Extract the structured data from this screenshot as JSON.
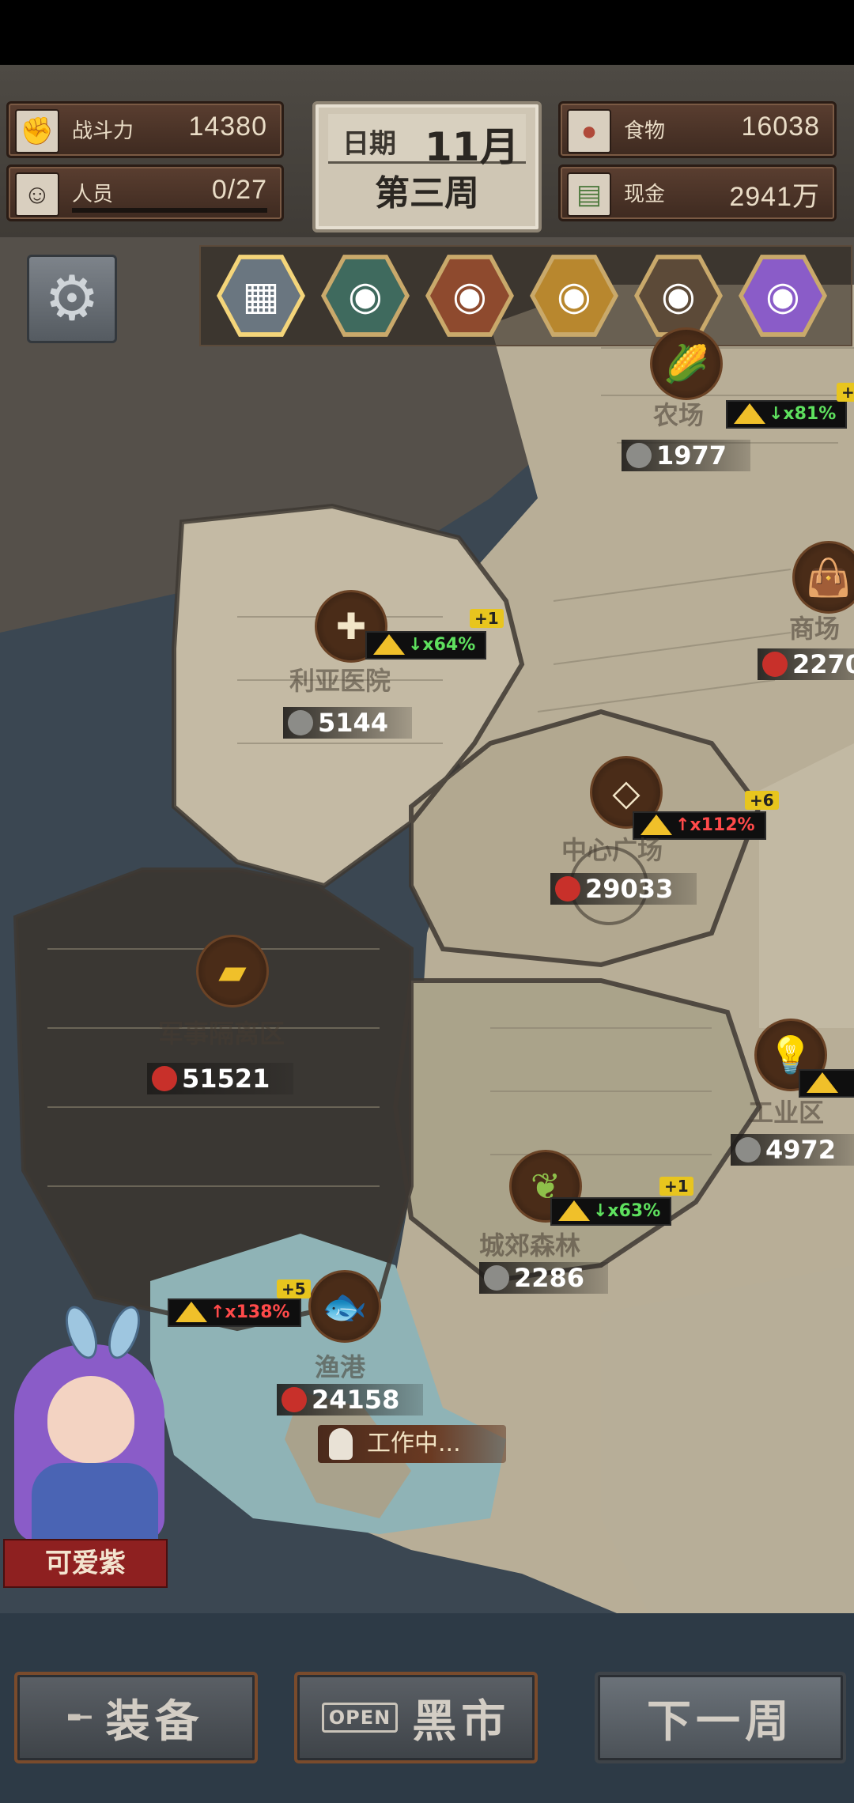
{
  "hud": {
    "combat": {
      "label": "战斗力",
      "value": "14380",
      "icon": "fist-icon"
    },
    "staff": {
      "label": "人员",
      "value": "0/27",
      "icon": "person-icon"
    },
    "food": {
      "label": "食物",
      "value": "16038",
      "icon": "meat-icon"
    },
    "cash": {
      "label": "现金",
      "value": "2941万",
      "icon": "cash-icon"
    },
    "date_label": "日期",
    "month": "11月",
    "week": "第三周"
  },
  "characters": [
    {
      "name": "base",
      "icon": "building-icon",
      "selected": true
    },
    {
      "name": "glasses-woman",
      "icon": "portrait-icon"
    },
    {
      "name": "brown-hair-girl",
      "icon": "portrait-icon"
    },
    {
      "name": "goggles-boy",
      "icon": "portrait-icon"
    },
    {
      "name": "cap-boy",
      "icon": "portrait-icon"
    },
    {
      "name": "purple-girl",
      "icon": "portrait-icon"
    }
  ],
  "locations": {
    "farm": {
      "name": "农场",
      "value": "1977",
      "trend": "↓x81%",
      "plus": "+",
      "icon": "corn-icon"
    },
    "hospital": {
      "name": "利亚医院",
      "value": "5144",
      "trend": "↓x64%",
      "plus": "+1",
      "icon": "medicine-bottle-icon"
    },
    "mall": {
      "name": "商场",
      "value": "2270",
      "icon": "handbag-icon"
    },
    "plaza": {
      "name": "中心广场",
      "value": "29033",
      "trend": "↑x112%",
      "plus": "+6",
      "icon": "necklace-icon"
    },
    "military": {
      "name": "军事隔离区",
      "value": "51521",
      "icon": "gold-bars-icon"
    },
    "industrial": {
      "name": "工业区",
      "value": "4972",
      "icon": "lightbulb-icon"
    },
    "forest": {
      "name": "城郊森林",
      "value": "2286",
      "trend": "↓x63%",
      "plus": "+1",
      "icon": "herb-icon"
    },
    "harbor": {
      "name": "渔港",
      "value": "24158",
      "trend": "↑x138%",
      "plus": "+5",
      "icon": "fish-icon"
    }
  },
  "status": {
    "working": "工作中..."
  },
  "companion": {
    "name": "可爱紫"
  },
  "buttons": {
    "equipment": "装备",
    "black_market": "黑市",
    "open_sign": "OPEN",
    "next_week": "下一周"
  },
  "colors": {
    "danger": "#c8302a",
    "up": "#ff4a4a",
    "down": "#5ee05e",
    "warning": "#f0c02a"
  }
}
